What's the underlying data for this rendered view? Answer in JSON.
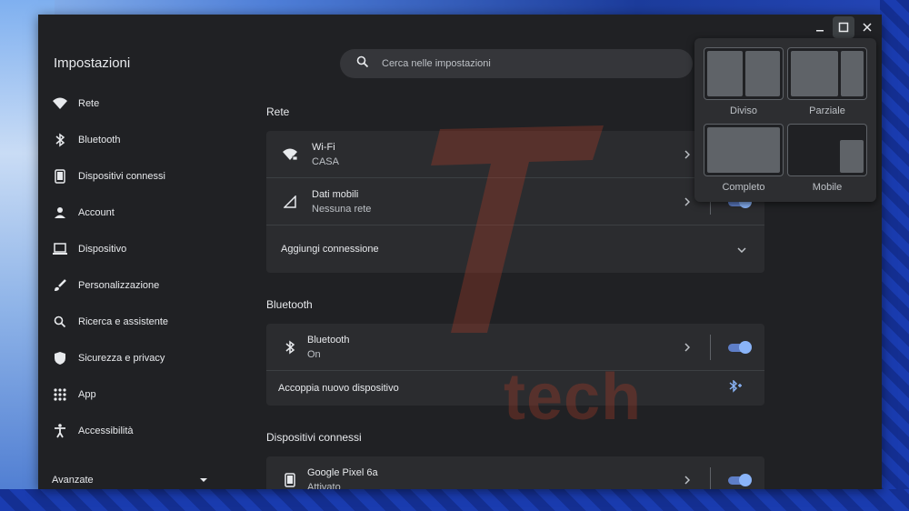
{
  "window": {
    "title_buttons": [
      "minimize-icon",
      "maximize-icon",
      "close-icon"
    ]
  },
  "app": {
    "title": "Impostazioni"
  },
  "search": {
    "placeholder": "Cerca nelle impostazioni",
    "icon": "search-icon"
  },
  "sidebar": {
    "items": [
      {
        "label": "Rete",
        "icon": "wifi-icon"
      },
      {
        "label": "Bluetooth",
        "icon": "bluetooth-icon"
      },
      {
        "label": "Dispositivi connessi",
        "icon": "phone-icon"
      },
      {
        "label": "Account",
        "icon": "person-icon"
      },
      {
        "label": "Dispositivo",
        "icon": "laptop-icon"
      },
      {
        "label": "Personalizzazione",
        "icon": "brush-icon"
      },
      {
        "label": "Ricerca e assistente",
        "icon": "search-icon"
      },
      {
        "label": "Sicurezza e privacy",
        "icon": "shield-icon"
      },
      {
        "label": "App",
        "icon": "apps-grid-icon"
      },
      {
        "label": "Accessibilità",
        "icon": "accessibility-icon"
      }
    ],
    "advanced": "Avanzate"
  },
  "sections": {
    "rete": {
      "title": "Rete",
      "wifi": {
        "title": "Wi-Fi",
        "subtitle": "CASA"
      },
      "mobile": {
        "title": "Dati mobili",
        "subtitle": "Nessuna rete"
      },
      "add": "Aggiungi connessione"
    },
    "bluetooth": {
      "title": "Bluetooth",
      "bt": {
        "title": "Bluetooth",
        "subtitle": "On"
      },
      "pair": "Accoppia nuovo dispositivo"
    },
    "devices": {
      "title": "Dispositivi connessi",
      "phone": {
        "title": "Google Pixel 6a",
        "subtitle": "Attivato"
      }
    }
  },
  "snap_menu": {
    "options": [
      "Diviso",
      "Parziale",
      "Completo",
      "Mobile"
    ]
  },
  "watermark": {
    "text": "tech"
  },
  "colors": {
    "accent": "#8ab4f8",
    "background": "#202124",
    "card": "#2b2c2f",
    "watermark": "#c0402a"
  }
}
